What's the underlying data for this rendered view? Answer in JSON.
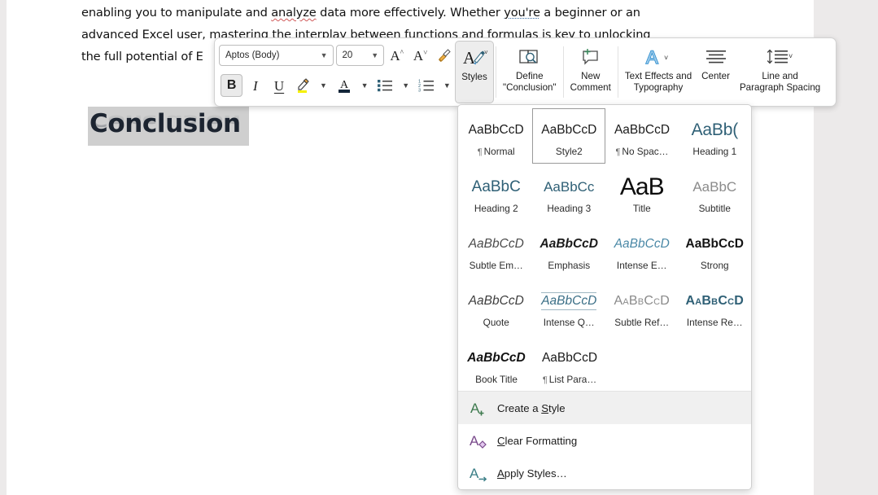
{
  "document": {
    "body_lines": [
      "enabling you to manipulate and analyze data more effectively. Whether you're a beginner or an",
      "advanced Excel user, mastering the interplay between functions and formulas is key to unlocking",
      "the full potential of E"
    ],
    "line1_a": "enabling you to manipulate and ",
    "line1_misspelled": "analyze",
    "line1_b": " data more effectively. Whether ",
    "line1_grammar": "you're",
    "line1_c": " a beginner or an",
    "line2": "advanced Excel user, mastering the interplay between functions and formulas is key to unlocking",
    "line3": "the full potential of E",
    "heading": "Conclusion"
  },
  "mini_toolbar": {
    "font_name": "Aptos (Body)",
    "font_size": "20",
    "grow_font_icon": "A^",
    "shrink_font_icon": "Aˇ",
    "format_painter_icon": "format-painter",
    "bold_label": "B",
    "italic_label": "I",
    "underline_label": "U",
    "highlight_icon": "text-highlight",
    "font_color_icon": "font-color",
    "bullets_icon": "bullet-list",
    "numbering_icon": "numbered-list",
    "caret": "ˇ",
    "buttons": [
      {
        "name": "styles",
        "label": "Styles",
        "icon": "styles-pen",
        "active": true
      },
      {
        "name": "define",
        "label": "Define\n\"Conclusion\"",
        "icon": "define-book-search",
        "active": false
      },
      {
        "name": "new-comment",
        "label": "New\nComment",
        "icon": "new-comment",
        "active": false
      },
      {
        "name": "text-effects",
        "label": "Text Effects and\nTypography",
        "icon": "text-effects-A",
        "active": false
      },
      {
        "name": "center",
        "label": "Center",
        "icon": "align-center",
        "active": false
      },
      {
        "name": "line-spacing",
        "label": "Line and\nParagraph Spacing",
        "icon": "line-spacing",
        "active": false
      }
    ]
  },
  "styles_gallery": {
    "rows": [
      [
        {
          "preview": "AaBbCcD",
          "name": "Normal",
          "pilcrow": true,
          "cls": "p-normal",
          "selected": false
        },
        {
          "preview": "AaBbCcD",
          "name": "Style2",
          "pilcrow": false,
          "cls": "p-normal",
          "selected": true
        },
        {
          "preview": "AaBbCcD",
          "name": "No Spac…",
          "pilcrow": true,
          "cls": "p-normal",
          "selected": false
        },
        {
          "preview": "AaBb(",
          "name": "Heading 1",
          "pilcrow": false,
          "cls": "p-h1",
          "selected": false
        }
      ],
      [
        {
          "preview": "AaBbC",
          "name": "Heading 2",
          "pilcrow": false,
          "cls": "p-h2",
          "selected": false
        },
        {
          "preview": "AaBbCc",
          "name": "Heading 3",
          "pilcrow": false,
          "cls": "p-h3",
          "selected": false
        },
        {
          "preview": "AaB",
          "name": "Title",
          "pilcrow": false,
          "cls": "p-title",
          "selected": false
        },
        {
          "preview": "AaBbC",
          "name": "Subtitle",
          "pilcrow": false,
          "cls": "p-subtitle",
          "selected": false
        }
      ],
      [
        {
          "preview": "AaBbCcD",
          "name": "Subtle Em…",
          "pilcrow": false,
          "cls": "p-subtleem",
          "selected": false
        },
        {
          "preview": "AaBbCcD",
          "name": "Emphasis",
          "pilcrow": false,
          "cls": "p-emph",
          "selected": false
        },
        {
          "preview": "AaBbCcD",
          "name": "Intense E…",
          "pilcrow": false,
          "cls": "p-intenseem",
          "selected": false
        },
        {
          "preview": "AaBbCcD",
          "name": "Strong",
          "pilcrow": false,
          "cls": "p-strong",
          "selected": false
        }
      ],
      [
        {
          "preview": "AaBbCcD",
          "name": "Quote",
          "pilcrow": false,
          "cls": "p-quote",
          "selected": false
        },
        {
          "preview": "AaBbCcD",
          "name": "Intense Q…",
          "pilcrow": false,
          "cls": "p-iquote",
          "selected": false
        },
        {
          "preview": "AaBbCcD",
          "name": "Subtle Ref…",
          "pilcrow": false,
          "cls": "p-subref",
          "selected": false
        },
        {
          "preview": "AaBbCcD",
          "name": "Intense Re…",
          "pilcrow": false,
          "cls": "p-intref",
          "selected": false
        }
      ],
      [
        {
          "preview": "AaBbCcD",
          "name": "Book Title",
          "pilcrow": false,
          "cls": "p-booktitle",
          "selected": false
        },
        {
          "preview": "AaBbCcD",
          "name": "List Para…",
          "pilcrow": true,
          "cls": "p-listpara",
          "selected": false
        }
      ]
    ],
    "menu_items": [
      {
        "name": "create-a-style",
        "pre": "Create a ",
        "key": "S",
        "post": "tyle",
        "icon": "A-plus",
        "color": "#3e7a4e",
        "hover": true
      },
      {
        "name": "clear-formatting",
        "pre": "",
        "key": "C",
        "post": "lear Formatting",
        "icon": "A-eraser",
        "color": "#7a4a8c",
        "hover": false
      },
      {
        "name": "apply-styles",
        "pre": "",
        "key": "A",
        "post": "pply Styles…",
        "icon": "A-arrow",
        "color": "#3b7f87",
        "hover": false
      }
    ]
  },
  "colors": {
    "accent_blue": "#2f6076",
    "selection_gray": "#cfcfcf",
    "page_bg": "#ffffff",
    "app_bg": "#eceaea",
    "highlight_yellow": "#f5f000"
  }
}
